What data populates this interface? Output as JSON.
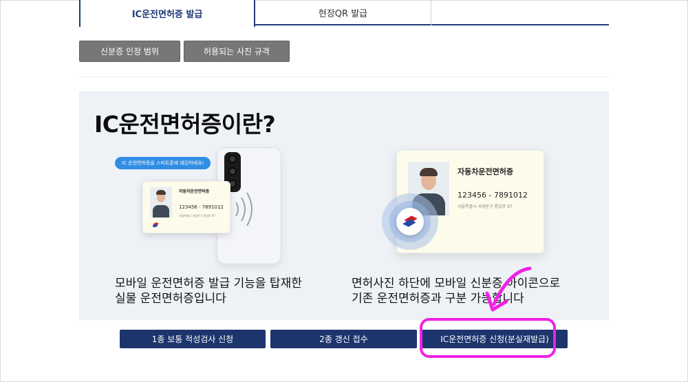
{
  "tabs": {
    "active_label": "IC운전면허증 발급",
    "second_label": "현장QR 발급"
  },
  "gray_buttons": {
    "scope_label": "신분증 인정 범위",
    "photo_spec_label": "허용되는 사진 규격"
  },
  "panel": {
    "title": "IC운전면허증이란?",
    "left": {
      "bubble": "IC 운전면허증을 스마트폰에 태깅하세요!",
      "card_title": "자동차운전면허증",
      "card_number": "123456 - 7891012",
      "card_address": "서울특별시 서대문구 통일로 97",
      "desc_line1": "모바일 운전면허증 발급 기능을 탑재한",
      "desc_line2": "실물 운전면허증입니다"
    },
    "right": {
      "card_title": "자동차운전면허증",
      "card_number": "123456 - 7891012",
      "card_address": "서울특별시 서대문구 통일로 97",
      "desc_line1": "면허사진 하단에 모바일 신분증 아이콘으로",
      "desc_line2": "기존 운전면허증과 구분 가능합니다"
    }
  },
  "blue_buttons": {
    "aptitude_label": "1종 보통 적성검사 신청",
    "renewal_label": "2종 갱신 접수",
    "ic_apply_label": "IC운전면허증 신청(분실재발급)"
  },
  "colors": {
    "navy": "#1c356d",
    "highlight": "#ee22e6",
    "panel_bg": "#eef1f5"
  }
}
